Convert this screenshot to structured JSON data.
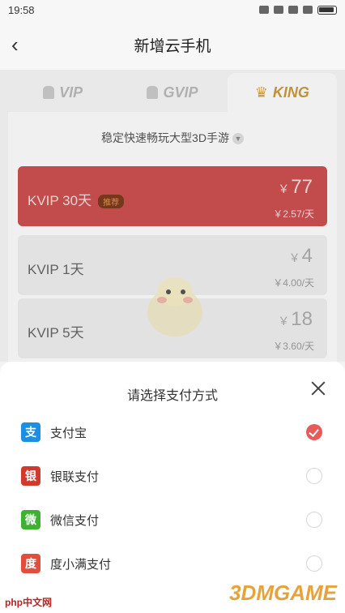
{
  "status": {
    "time": "19:58"
  },
  "header": {
    "title": "新增云手机",
    "back_glyph": "‹"
  },
  "tabs": [
    {
      "label": "VIP",
      "icon": "android-icon",
      "active": false
    },
    {
      "label": "GVIP",
      "icon": "android-icon",
      "active": false
    },
    {
      "label": "KING",
      "icon": "crown-icon",
      "active": true
    }
  ],
  "panel": {
    "subtitle": "稳定快速畅玩大型3D手游"
  },
  "plans": [
    {
      "name": "KVIP 30天",
      "badge": "推荐",
      "price": "77",
      "unit": "￥2.57/天",
      "selected": true
    },
    {
      "name": "KVIP 1天",
      "price": "4",
      "unit": "￥4.00/天",
      "selected": false
    },
    {
      "name": "KVIP 5天",
      "price": "18",
      "unit": "￥3.60/天",
      "selected": false
    }
  ],
  "currency": "￥",
  "sheet": {
    "title": "请选择支付方式",
    "methods": [
      {
        "label": "支付宝",
        "icon": "alipay-icon",
        "color": "#1a8fe3",
        "glyph": "支",
        "checked": true
      },
      {
        "label": "银联支付",
        "icon": "unionpay-icon",
        "color": "#d13a2b",
        "glyph": "银",
        "checked": false
      },
      {
        "label": "微信支付",
        "icon": "wechat-icon",
        "color": "#3eb135",
        "glyph": "微",
        "checked": false
      },
      {
        "label": "度小满支付",
        "icon": "duxiaoman-icon",
        "color": "#e34d3b",
        "glyph": "度",
        "checked": false
      }
    ]
  },
  "watermarks": {
    "left": "php中文网",
    "right": "3DMGAME"
  }
}
